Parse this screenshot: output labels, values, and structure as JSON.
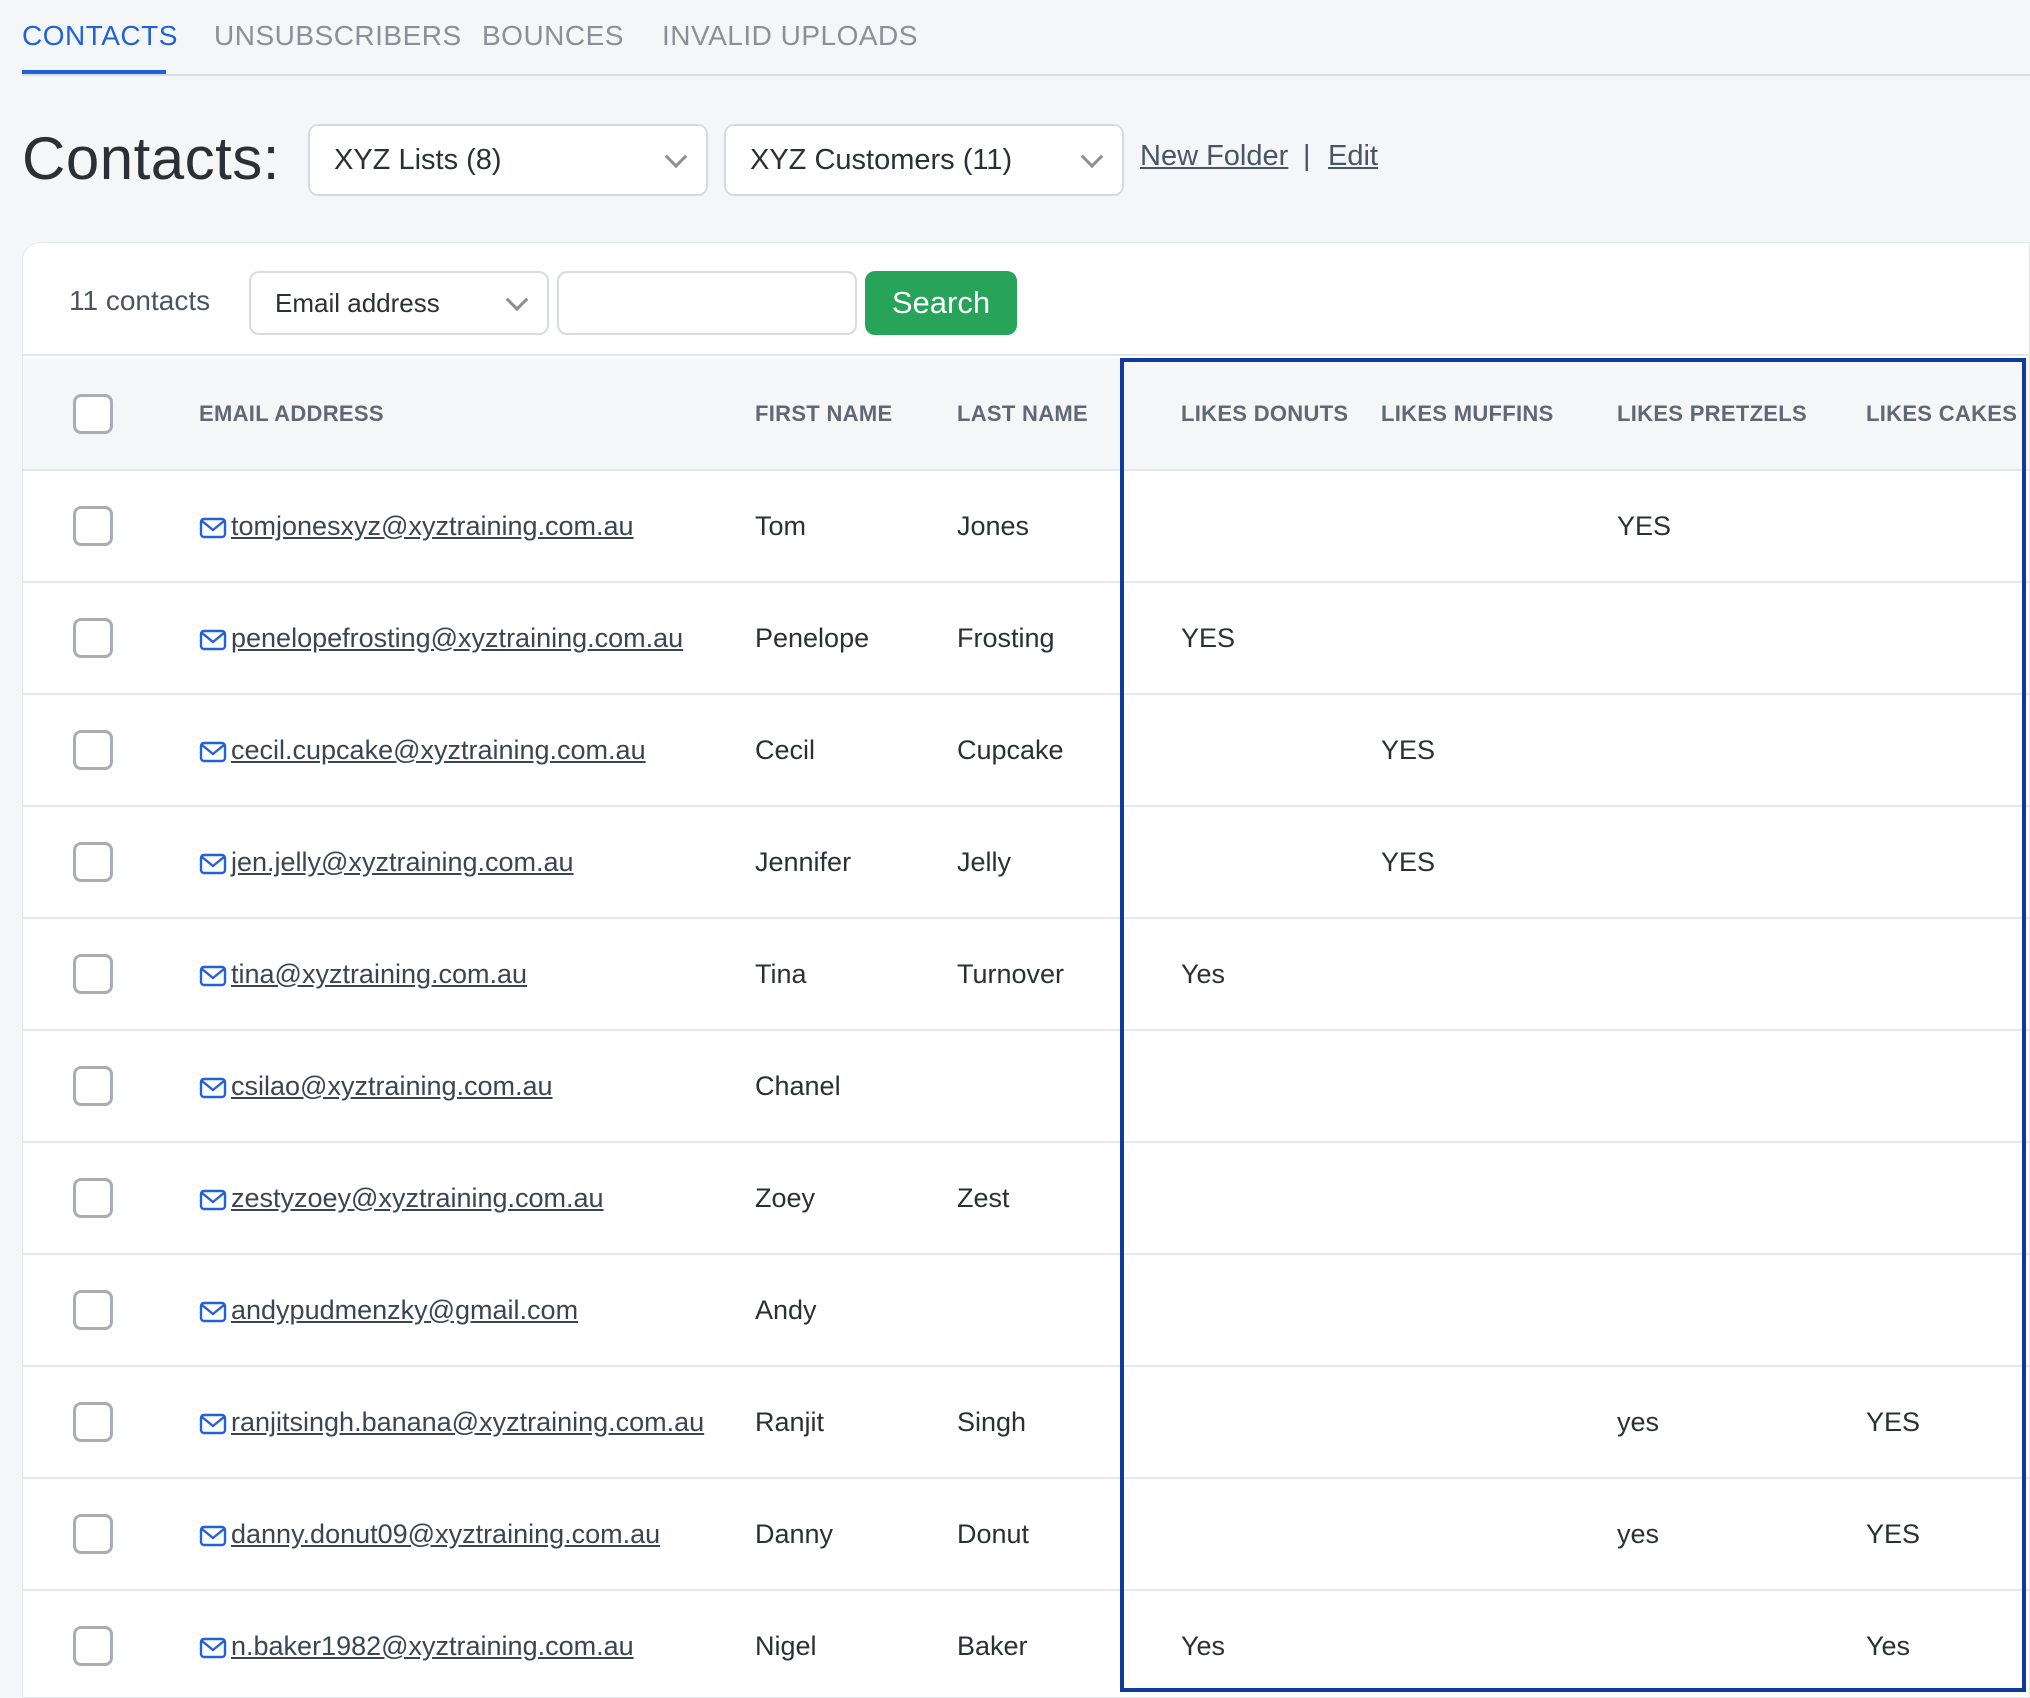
{
  "tabs": [
    {
      "label": "CONTACTS",
      "active": true
    },
    {
      "label": "UNSUBSCRIBERS",
      "active": false
    },
    {
      "label": "BOUNCES",
      "active": false
    },
    {
      "label": "INVALID UPLOADS",
      "active": false
    }
  ],
  "header": {
    "title": "Contacts:",
    "list_select": "XYZ Lists (8)",
    "folder_select": "XYZ Customers (11)",
    "new_folder_link": "New Folder",
    "separator": "|",
    "edit_link": "Edit"
  },
  "toolbar": {
    "count": "11 contacts",
    "field_select": "Email address",
    "search_value": "",
    "search_label": "Search"
  },
  "table": {
    "columns": [
      "EMAIL ADDRESS",
      "FIRST NAME",
      "LAST NAME",
      "LIKES DONUTS",
      "LIKES MUFFINS",
      "LIKES PRETZELS",
      "LIKES CAKES"
    ],
    "rows": [
      {
        "email": "tomjonesxyz@xyztraining.com.au",
        "first": "Tom",
        "last": "Jones",
        "donuts": "",
        "muffins": "",
        "pretzels": "YES",
        "cakes": ""
      },
      {
        "email": "penelopefrosting@xyztraining.com.au",
        "first": "Penelope",
        "last": "Frosting",
        "donuts": "YES",
        "muffins": "",
        "pretzels": "",
        "cakes": ""
      },
      {
        "email": "cecil.cupcake@xyztraining.com.au",
        "first": "Cecil",
        "last": "Cupcake",
        "donuts": "",
        "muffins": "YES",
        "pretzels": "",
        "cakes": ""
      },
      {
        "email": "jen.jelly@xyztraining.com.au",
        "first": "Jennifer",
        "last": "Jelly",
        "donuts": "",
        "muffins": "YES",
        "pretzels": "",
        "cakes": ""
      },
      {
        "email": "tina@xyztraining.com.au",
        "first": "Tina",
        "last": "Turnover",
        "donuts": "Yes",
        "muffins": "",
        "pretzels": "",
        "cakes": ""
      },
      {
        "email": "csilao@xyztraining.com.au",
        "first": "Chanel",
        "last": "",
        "donuts": "",
        "muffins": "",
        "pretzels": "",
        "cakes": ""
      },
      {
        "email": "zestyzoey@xyztraining.com.au",
        "first": "Zoey",
        "last": "Zest",
        "donuts": "",
        "muffins": "",
        "pretzels": "",
        "cakes": ""
      },
      {
        "email": "andypudmenzky@gmail.com",
        "first": "Andy",
        "last": "",
        "donuts": "",
        "muffins": "",
        "pretzels": "",
        "cakes": ""
      },
      {
        "email": "ranjitsingh.banana@xyztraining.com.au",
        "first": "Ranjit",
        "last": "Singh",
        "donuts": "",
        "muffins": "",
        "pretzels": "yes",
        "cakes": "YES"
      },
      {
        "email": "danny.donut09@xyztraining.com.au",
        "first": "Danny",
        "last": "Donut",
        "donuts": "",
        "muffins": "",
        "pretzels": "yes",
        "cakes": "YES"
      },
      {
        "email": "n.baker1982@xyztraining.com.au",
        "first": "Nigel",
        "last": "Baker",
        "donuts": "Yes",
        "muffins": "",
        "pretzels": "",
        "cakes": "Yes"
      }
    ]
  },
  "colors": {
    "accent": "#1f63d6",
    "search_button": "#27a35a",
    "highlight_border": "#0e3a99"
  }
}
